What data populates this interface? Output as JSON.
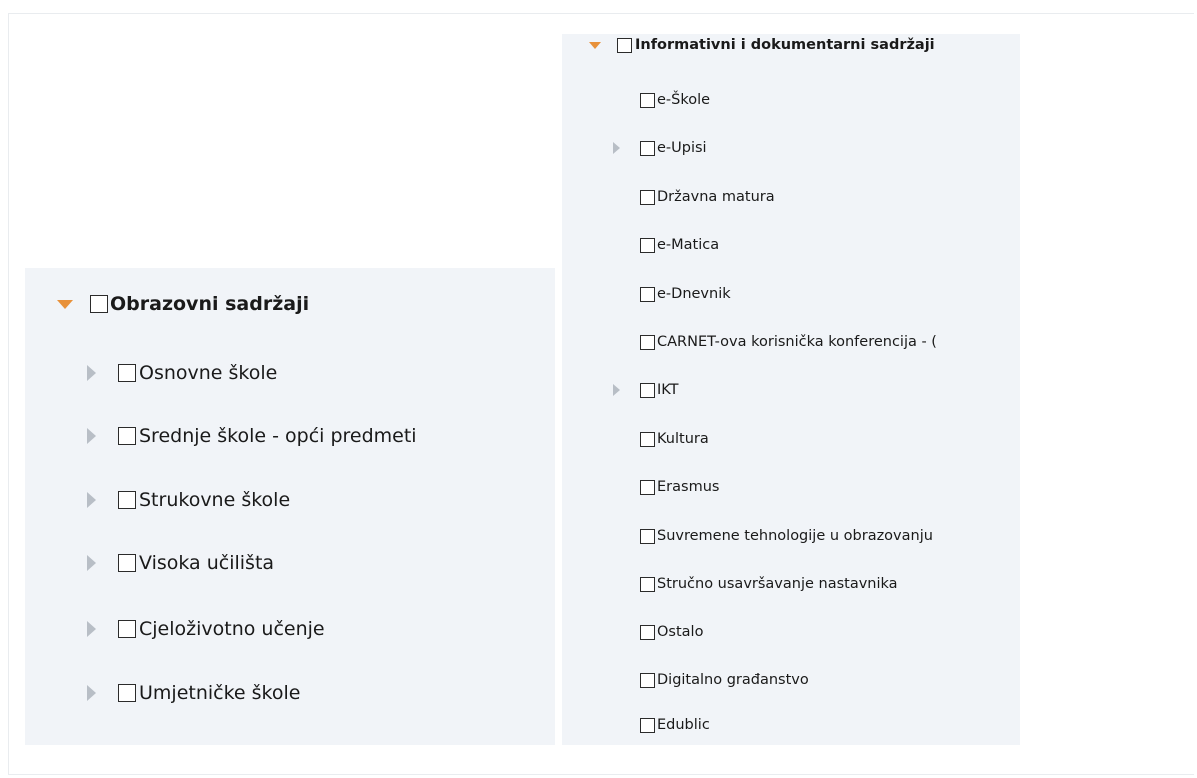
{
  "left_tree": {
    "root_label": "Obrazovni sadržaji",
    "children": [
      {
        "label": "Osnovne škole",
        "has_children": true
      },
      {
        "label": "Srednje škole - opći predmeti",
        "has_children": true
      },
      {
        "label": "Strukovne škole",
        "has_children": true
      },
      {
        "label": "Visoka učilišta",
        "has_children": true
      },
      {
        "label": "Cjeloživotno učenje",
        "has_children": true
      },
      {
        "label": "Umjetničke škole",
        "has_children": true
      }
    ]
  },
  "right_tree": {
    "root_label": "Informativni i dokumentarni sadržaji",
    "children": [
      {
        "label": "e-Škole",
        "has_children": false
      },
      {
        "label": "e-Upisi",
        "has_children": true
      },
      {
        "label": "Državna matura",
        "has_children": false
      },
      {
        "label": "e-Matica",
        "has_children": false
      },
      {
        "label": "e-Dnevnik",
        "has_children": false
      },
      {
        "label": "CARNET-ova korisnička konferencija - (",
        "has_children": false
      },
      {
        "label": "IKT",
        "has_children": true
      },
      {
        "label": "Kultura",
        "has_children": false
      },
      {
        "label": "Erasmus",
        "has_children": false
      },
      {
        "label": "Suvremene tehnologije u obrazovanju",
        "has_children": false
      },
      {
        "label": "Stručno usavršavanje nastavnika",
        "has_children": false
      },
      {
        "label": "Ostalo",
        "has_children": false
      },
      {
        "label": "Digitalno građanstvo",
        "has_children": false
      },
      {
        "label": "Edublic",
        "has_children": false
      }
    ]
  },
  "colors": {
    "panel_bg": "#f1f4f8",
    "expanded_caret": "#e8913a",
    "collapsed_caret": "#b8bec6"
  }
}
